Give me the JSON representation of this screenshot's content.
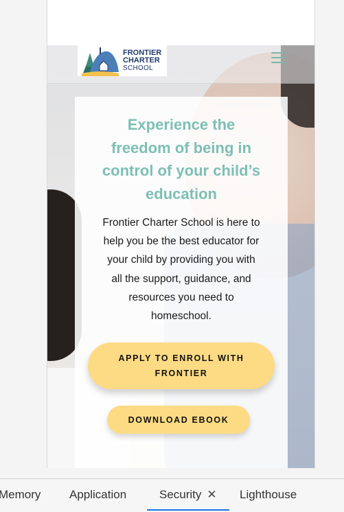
{
  "header": {
    "logo": {
      "line1": "FRONTIER",
      "line2": "CHARTER",
      "line3": "SCHOOL",
      "icon": "trees-school-logo"
    },
    "menu_icon": "hamburger-menu-icon"
  },
  "hero": {
    "headline": [
      "Experience the",
      "freedom of being in",
      "control of your child’s",
      "education"
    ],
    "body": [
      "Frontier Charter School is here to",
      "help you be the best educator for",
      "your child by providing you with",
      "all the support, guidance, and",
      "resources you need to",
      "homeschool."
    ],
    "primary_button": [
      "APPLY TO ENROLL WITH",
      "FRONTIER"
    ],
    "secondary_button": "DOWNLOAD EBOOK"
  },
  "devtools": {
    "tabs": [
      {
        "label": "Memory",
        "active": false
      },
      {
        "label": "Application",
        "active": false
      },
      {
        "label": "Security",
        "active": true,
        "closable": true
      },
      {
        "label": "Lighthouse",
        "active": false
      }
    ],
    "close_icon": "✕"
  },
  "colors": {
    "accent_teal": "#7dbfb5",
    "button_yellow": "#fddb84",
    "active_tab": "#1a73e8",
    "logo_navy": "#1f3a6b"
  }
}
